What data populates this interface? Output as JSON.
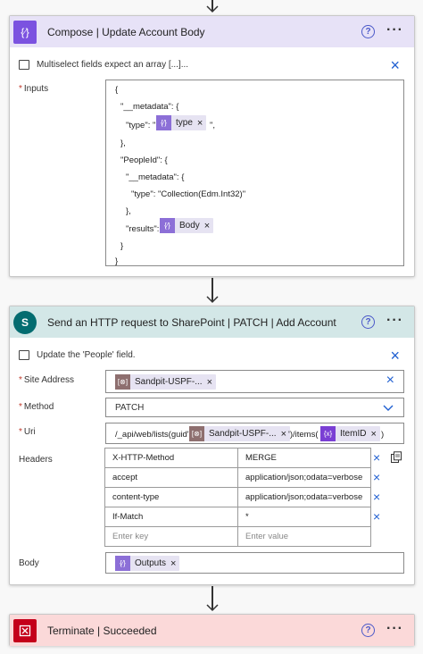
{
  "compose": {
    "title": "Compose | Update Account Body",
    "icon": "compose-icon",
    "color": "#7b52e0",
    "header_bg": "#e7e2f7",
    "note": "Multiselect fields expect an array [...]...",
    "inputs_label": "Inputs",
    "lines": [
      "{",
      "\"__metadata\": {",
      "\"type\": \"",
      "\",",
      "},",
      "\"PeopleId\": {",
      "\"__metadata\": {",
      "\"type\": \"Collection(Edm.Int32)\"",
      "},",
      "\"results\":",
      "}",
      "}"
    ],
    "type_token": "type",
    "body_token": "Body"
  },
  "http": {
    "title": "Send an HTTP request to SharePoint | PATCH | Add Account",
    "color": "#036c70",
    "header_bg": "#d3e7e7",
    "note": "Update the 'People' field.",
    "site_label": "Site Address",
    "site_token": "Sandpit-USPF-...",
    "method_label": "Method",
    "method_value": "PATCH",
    "uri_label": "Uri",
    "uri_prefix": "/_api/web/lists(guid'",
    "uri_token1": "Sandpit-USPF-...",
    "uri_middle": "')/items(",
    "uri_token2": "ItemID",
    "uri_suffix": ")",
    "headers_label": "Headers",
    "headers": [
      {
        "key": "X-HTTP-Method",
        "value": "MERGE"
      },
      {
        "key": "accept",
        "value": "application/json;odata=verbose"
      },
      {
        "key": "content-type",
        "value": "application/json;odata=verbose"
      },
      {
        "key": "If-Match",
        "value": "*"
      }
    ],
    "key_placeholder": "Enter key",
    "value_placeholder": "Enter value",
    "body_label": "Body",
    "body_token": "Outputs"
  },
  "terminate": {
    "title": "Terminate | Succeeded",
    "color": "#c4001a",
    "header_bg": "#fbd9d9"
  },
  "common": {
    "help": "?",
    "more": "···",
    "close": "×",
    "remove": "×",
    "required": "*"
  }
}
